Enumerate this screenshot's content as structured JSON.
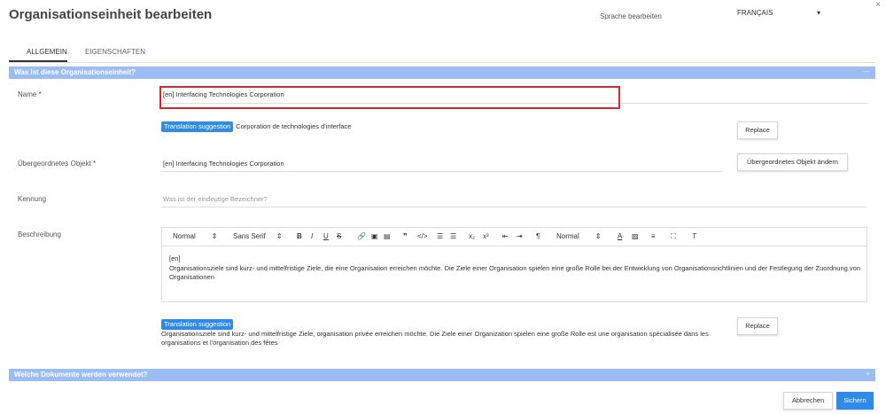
{
  "header": {
    "title": "Organisationseinheit bearbeiten",
    "close": "×",
    "language_label": "Sprache bearbeiten",
    "language_value": "FRANÇAIS",
    "language_caret": "▾"
  },
  "tabs": [
    {
      "label": "ALLGEMEIN",
      "active": true
    },
    {
      "label": "EIGENSCHAFTEN",
      "active": false
    }
  ],
  "section1": {
    "title": "Was ist diese Organisationseinheit?",
    "toggle": "—"
  },
  "section2": {
    "title": "Welche Dokumente werden verwendet?",
    "toggle": "+"
  },
  "fields": {
    "name": {
      "label": "Name *",
      "value": "[en] Interfacing Technologies Corporation",
      "suggestion_badge": "Translation suggestion",
      "suggestion_text": "Corporation de technologies d'interface",
      "replace_label": "Replace"
    },
    "parent": {
      "label": "Übergeordnetes Objekt *",
      "value": "[en] Interfacing Technologies Corporation",
      "change_label": "Übergeordnetes Objekt ändern"
    },
    "key": {
      "label": "Kennung",
      "placeholder": "Was ist der eindeutige Bezeichner?"
    },
    "description": {
      "label": "Beschreibung",
      "toolbar": {
        "format": "Normal",
        "font": "Sans Serif",
        "size": "Normal",
        "sel_caret": "⇕"
      },
      "body_lang": "[en]",
      "body_text": "Organisationsziele sind kurz- und mittelfristige Ziele, die eine Organisation erreichen möchte. Die Ziele einer Organisation spielen eine große Rolle bei der Entwicklung von Organisationsrichtlinien und der Festlegung der Zuordnung von Organisationen",
      "suggestion_badge": "Translation suggestion",
      "suggestion_text": "Organisationsziele sind kurz- und mittelfristige Ziele, organisation privée erreichen möchte. Die Ziele einer Organization spielen eine große Rolle est une organisation spécialisée dans les organisations et l'organisation des fêtes",
      "replace_label": "Replace"
    }
  },
  "footer": {
    "cancel_label": "Abbrechen",
    "save_label": "Sichern"
  },
  "colors": {
    "section_bar": "#9bbdf3",
    "accent": "#2f8be6",
    "highlight": "#d9272e"
  }
}
